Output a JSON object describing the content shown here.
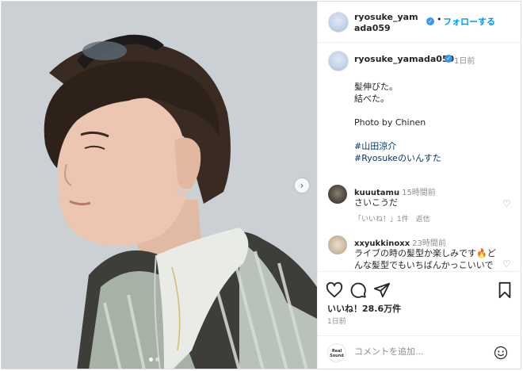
{
  "header": {
    "username": "ryosuke_yamada059",
    "dot": "•",
    "follow_label": "フォローする"
  },
  "caption": {
    "username": "ryosuke_yamada059",
    "time": "1日前",
    "lines": [
      "髪伸びた。",
      "結べた。",
      "",
      "Photo by Chinen",
      ""
    ],
    "hashtags": [
      "#山田涼介",
      "#Ryosukeのいんすた"
    ]
  },
  "comments": [
    {
      "username": "kuuutamu",
      "time": "15時間前",
      "text": "さいこうだ",
      "likes": "「いいね！」1件",
      "reply": "返信"
    },
    {
      "username": "xxyukkinoxx",
      "time": "23時間前",
      "text": "ライブの時の髪型か楽しみです🔥どんな髪型でもいちばんかっこいいで"
    }
  ],
  "actions": {
    "likes_text": "いいね！28.6万件",
    "posted": "1日前"
  },
  "comment_box": {
    "placeholder": "コメントを追加...",
    "logo_text": "Real Sound"
  },
  "icons": [
    "like-icon",
    "comment-icon",
    "share-icon",
    "save-icon",
    "emoji-icon",
    "verified-icon",
    "chevron-right-icon"
  ],
  "colors": {
    "accent": "#0095f6",
    "verified": "#3897f0",
    "hashtag": "#00376b",
    "muted": "#8e8e8e"
  }
}
